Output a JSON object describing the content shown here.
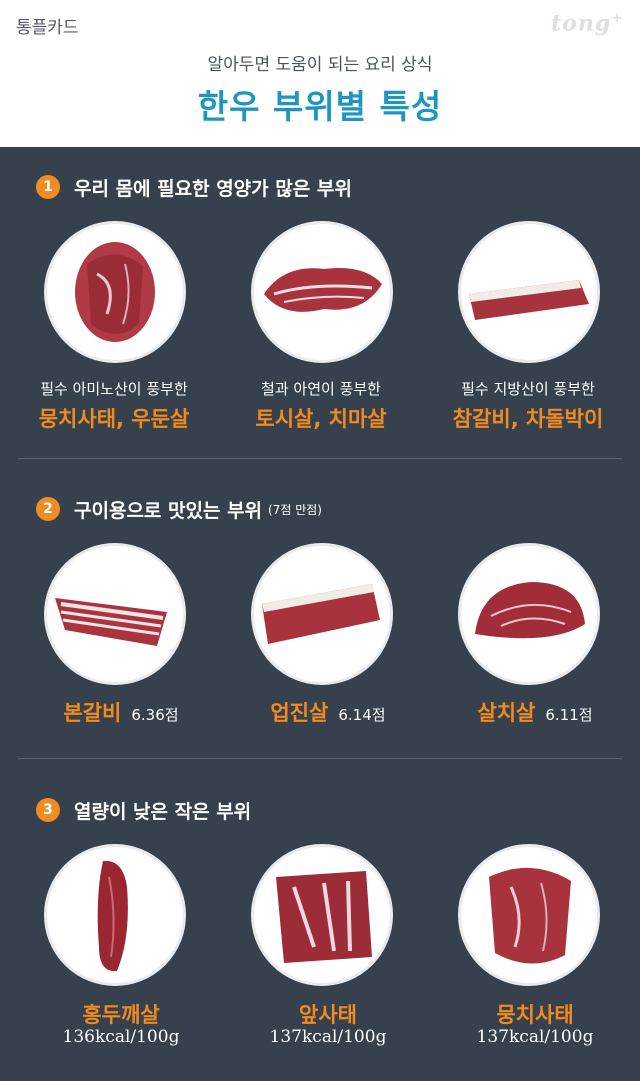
{
  "header": {
    "brand": "통플카드",
    "logo": "tong",
    "logo_plus": "+",
    "subtitle": "알아두면 도움이 되는 요리 상식",
    "title": "한우 부위별 특성"
  },
  "sections": [
    {
      "number": "1",
      "title": "우리 몸에 필요한 영양가 많은 부위",
      "items": [
        {
          "desc": "필수 아미노산이 풍부한",
          "name": "뭉치사태, 우둔살",
          "image": "beef-shank-round"
        },
        {
          "desc": "철과 아연이 풍부한",
          "name": "토시살, 치마살",
          "image": "beef-skirt-flank"
        },
        {
          "desc": "필수 지방산이 풍부한",
          "name": "참갈비, 차돌박이",
          "image": "beef-rib-brisket"
        }
      ]
    },
    {
      "number": "2",
      "title": "구이용으로 맛있는 부위",
      "note": "(7점 만점)",
      "items": [
        {
          "name": "본갈비",
          "score": "6.36점",
          "image": "beef-ribs"
        },
        {
          "name": "업진살",
          "score": "6.14점",
          "image": "beef-plate"
        },
        {
          "name": "살치살",
          "score": "6.11점",
          "image": "beef-chuck-flap"
        }
      ]
    },
    {
      "number": "3",
      "title": "열량이 낮은 작은 부위",
      "items": [
        {
          "name": "홍두깨살",
          "kcal": "136kcal/100g",
          "image": "beef-eye-round"
        },
        {
          "name": "앞사태",
          "kcal": "137kcal/100g",
          "image": "beef-fore-shank"
        },
        {
          "name": "뭉치사태",
          "kcal": "137kcal/100g",
          "image": "beef-heel-shank"
        }
      ]
    }
  ],
  "colors": {
    "background": "#37404d",
    "accent": "#f08c21",
    "title_blue": "#1f95c1",
    "meat_red": "#a0303a"
  }
}
